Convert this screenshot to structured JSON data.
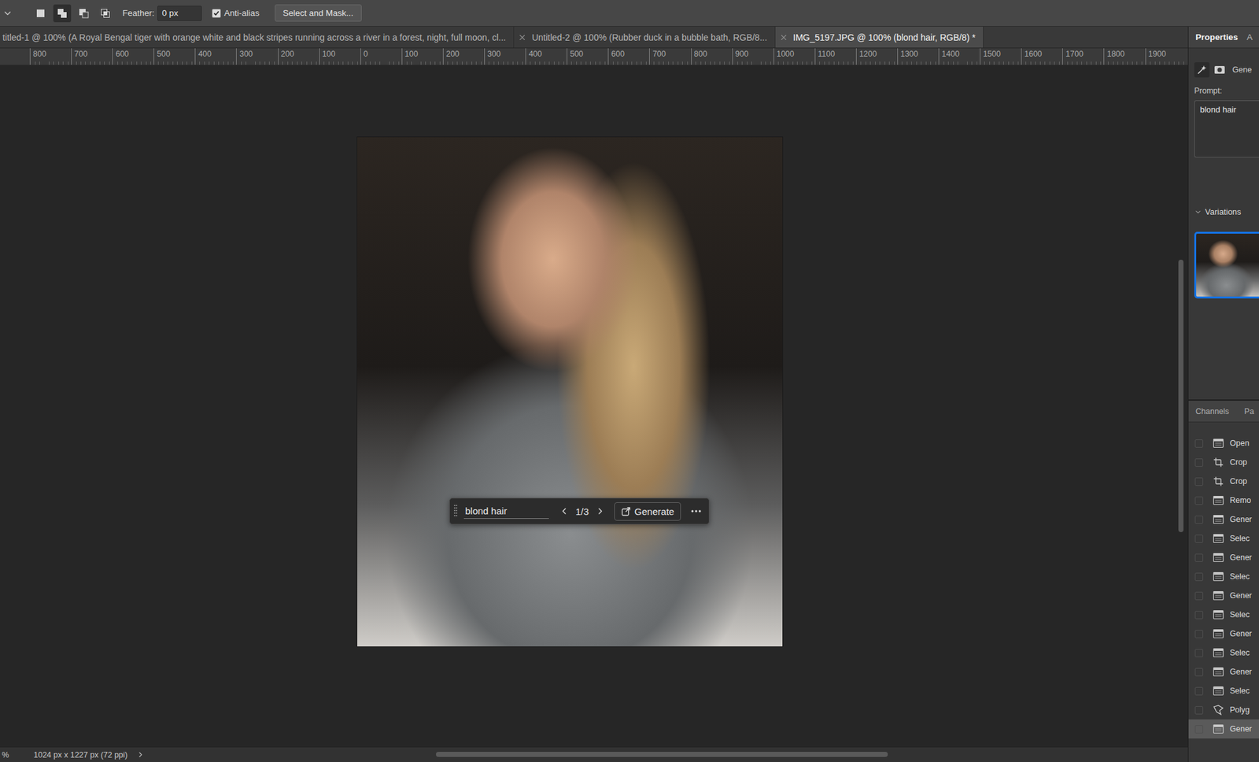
{
  "options_bar": {
    "modes": [
      {
        "name": "new",
        "selected": false
      },
      {
        "name": "add",
        "selected": true
      },
      {
        "name": "subtract",
        "selected": false
      },
      {
        "name": "intersect",
        "selected": false
      }
    ],
    "feather": {
      "label": "Feather:",
      "value": "0 px"
    },
    "anti_alias": {
      "label": "Anti-alias",
      "checked": true
    },
    "select_and_mask": "Select and Mask..."
  },
  "tabs": [
    {
      "label": "titled-1 @ 100% (A Royal Bengal tiger with orange white and black stripes running across a river in a forest, night, full moon, cl...",
      "selected": false,
      "closable": false
    },
    {
      "label": "Untitled-2 @ 100% (Rubber duck in a bubble bath, RGB/8...",
      "selected": false,
      "closable": true
    },
    {
      "label": "IMG_5197.JPG @ 100% (blond hair, RGB/8) *",
      "selected": true,
      "closable": true
    }
  ],
  "ruler": {
    "labels": [
      "800",
      "700",
      "600",
      "500",
      "400",
      "300",
      "200",
      "100",
      "0",
      "100",
      "200",
      "300",
      "400",
      "500",
      "600",
      "700",
      "800",
      "900",
      "1000",
      "1100",
      "1200",
      "1300",
      "1400",
      "1500",
      "1600",
      "1700",
      "1800",
      "1900"
    ]
  },
  "task_bar": {
    "prompt": "blond hair",
    "counter": "1/3",
    "generate": "Generate"
  },
  "properties_panel": {
    "tabs": [
      {
        "label": "Properties",
        "selected": true
      },
      {
        "label": "A",
        "selected": false
      }
    ],
    "mode_buttons": [
      {
        "name": "generative",
        "selected": true
      },
      {
        "name": "mask",
        "selected": false
      }
    ],
    "mode_label": "Gene",
    "prompt_label": "Prompt:",
    "prompt": "blond hair",
    "variations": {
      "label": "Variations",
      "expanded": true,
      "items": [
        {
          "selected": true
        }
      ]
    }
  },
  "history_panel": {
    "tabs": [
      {
        "label": "Channels",
        "selected": false
      },
      {
        "label": "Pa",
        "selected": false
      }
    ],
    "steps": [
      {
        "label": "Open",
        "kind": "step",
        "selected": false
      },
      {
        "label": "Crop",
        "kind": "crop",
        "selected": false
      },
      {
        "label": "Crop",
        "kind": "crop",
        "selected": false
      },
      {
        "label": "Remo",
        "kind": "step",
        "selected": false
      },
      {
        "label": "Gener",
        "kind": "step",
        "selected": false
      },
      {
        "label": "Selec",
        "kind": "step",
        "selected": false
      },
      {
        "label": "Gener",
        "kind": "step",
        "selected": false
      },
      {
        "label": "Selec",
        "kind": "step",
        "selected": false
      },
      {
        "label": "Gener",
        "kind": "step",
        "selected": false
      },
      {
        "label": "Selec",
        "kind": "step",
        "selected": false
      },
      {
        "label": "Gener",
        "kind": "step",
        "selected": false
      },
      {
        "label": "Selec",
        "kind": "step",
        "selected": false
      },
      {
        "label": "Gener",
        "kind": "step",
        "selected": false
      },
      {
        "label": "Selec",
        "kind": "step",
        "selected": false
      },
      {
        "label": "Polyg",
        "kind": "lasso",
        "selected": false
      },
      {
        "label": "Gener",
        "kind": "step",
        "selected": true
      }
    ]
  },
  "status_bar": {
    "zoom": "%",
    "doc_info": "1024 px x 1227 px (72 ppi)"
  },
  "scrollbars": {
    "vertical": {
      "start": 0.285,
      "size": 0.4
    },
    "horizontal": {
      "start": 0.276,
      "size": 0.448
    }
  }
}
